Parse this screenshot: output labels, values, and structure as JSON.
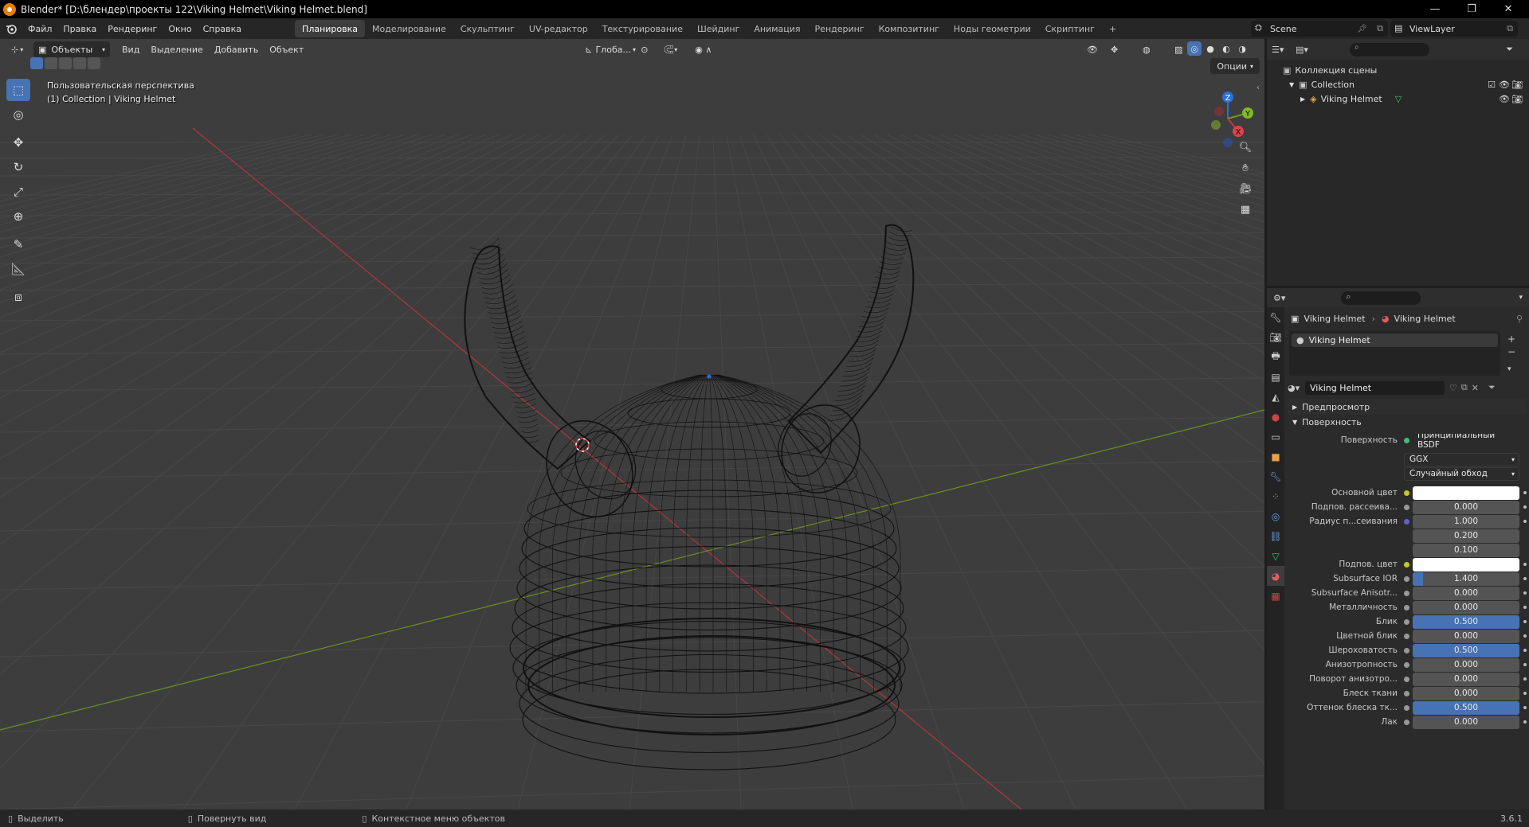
{
  "window": {
    "title": "Blender* [D:\\блендер\\проекты 122\\Viking Helmet\\Viking Helmet.blend]",
    "minimize": "—",
    "maximize": "❐",
    "close": "✕"
  },
  "menu": {
    "items": [
      "Файл",
      "Правка",
      "Рендеринг",
      "Окно",
      "Справка"
    ],
    "workspaces": [
      "Планировка",
      "Моделирование",
      "Скульптинг",
      "UV-редактор",
      "Текстурирование",
      "Шейдинг",
      "Анимация",
      "Рендеринг",
      "Композитинг",
      "Ноды геометрии",
      "Скриптинг"
    ],
    "active_workspace": "Планировка",
    "add_workspace": "+",
    "scene_name": "Scene",
    "view_layer": "ViewLayer"
  },
  "viewport": {
    "mode": "Объекты",
    "menus": [
      "Вид",
      "Выделение",
      "Добавить",
      "Объект"
    ],
    "orientation": "Глоба...",
    "options_label": "Опции",
    "view_name": "Пользовательская перспектива",
    "collection_info": "(1) Collection | Viking Helmet",
    "gizmo_labels": {
      "z": "Z",
      "y": "Y",
      "x": "X"
    },
    "colors": {
      "background": "#3d3d3d",
      "x_axis": "#b5343f",
      "y_axis": "#6b8f23",
      "wire": "#111111"
    }
  },
  "outliner": {
    "scene_collection": "Коллекция сцены",
    "collection": "Collection",
    "object": "Viking Helmet"
  },
  "properties": {
    "breadcrumb_object": "Viking Helmet",
    "breadcrumb_material": "Viking Helmet",
    "slot_name": "Viking Helmet",
    "material_name": "Viking Helmet",
    "sections": {
      "preview": "Предпросмотр",
      "surface": "Поверхность"
    },
    "surface_label": "Поверхность",
    "surface_shader": "Принципиальный BSDF",
    "distribution": "GGX",
    "subsurface_method": "Случайный обход",
    "params": [
      {
        "label": "Основной цвет",
        "value": "",
        "kind": "color",
        "color": "#ffffff",
        "dot": "#c6c62a"
      },
      {
        "label": "Подпов. рассеива...",
        "value": "0.000",
        "kind": "num",
        "fill": 0,
        "dot": "#999999"
      },
      {
        "label": "Радиус п...сеивания",
        "value": "1.000",
        "kind": "num",
        "fill": 0,
        "dot": "#6363c7"
      },
      {
        "label": "",
        "value": "0.200",
        "kind": "num",
        "fill": 0,
        "dot": ""
      },
      {
        "label": "",
        "value": "0.100",
        "kind": "num",
        "fill": 0,
        "dot": ""
      },
      {
        "label": "Подпов. цвет",
        "value": "",
        "kind": "color",
        "color": "#ffffff",
        "dot": "#c6c62a"
      },
      {
        "label": "Subsurface IOR",
        "value": "1.400",
        "kind": "num",
        "fill": 0.1,
        "dot": "#999999"
      },
      {
        "label": "Subsurface Anisotr...",
        "value": "0.000",
        "kind": "num",
        "fill": 0,
        "dot": "#999999"
      },
      {
        "label": "Металличность",
        "value": "0.000",
        "kind": "num",
        "fill": 0,
        "dot": "#999999"
      },
      {
        "label": "Блик",
        "value": "0.500",
        "kind": "num",
        "fill": 1,
        "dot": "#999999"
      },
      {
        "label": "Цветной блик",
        "value": "0.000",
        "kind": "num",
        "fill": 0,
        "dot": "#999999"
      },
      {
        "label": "Шероховатость",
        "value": "0.500",
        "kind": "num",
        "fill": 1,
        "dot": "#999999"
      },
      {
        "label": "Анизотропность",
        "value": "0.000",
        "kind": "num",
        "fill": 0,
        "dot": "#999999"
      },
      {
        "label": "Поворот анизотро...",
        "value": "0.000",
        "kind": "num",
        "fill": 0,
        "dot": "#999999"
      },
      {
        "label": "Блеск ткани",
        "value": "0.000",
        "kind": "num",
        "fill": 0,
        "dot": "#999999"
      },
      {
        "label": "Оттенок блеска тк...",
        "value": "0.500",
        "kind": "num",
        "fill": 1,
        "dot": "#999999"
      },
      {
        "label": "Лак",
        "value": "0.000",
        "kind": "num",
        "fill": 0,
        "dot": "#999999"
      }
    ]
  },
  "statusbar": {
    "select": "Выделить",
    "rotate": "Повернуть вид",
    "context_menu": "Контекстное меню объектов",
    "version": "3.6.1"
  }
}
